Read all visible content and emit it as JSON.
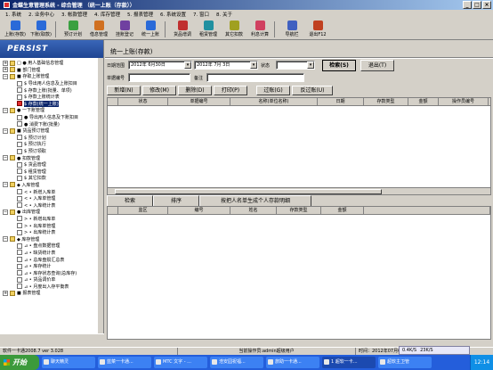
{
  "window": {
    "title": "金蝶生意管理系统 - 综合管理  （统一上账（存款））",
    "min": "_",
    "max": "□",
    "close": "×"
  },
  "menu": [
    "1. 系统",
    "2. 业务中心",
    "3. 帐款管理",
    "4. 库存管理",
    "5. 报表管理",
    "6. 系统设置",
    "7. 窗口",
    "8. 关于"
  ],
  "toolbar": [
    {
      "label": "上账(存款)",
      "icon_color": "#2a6ad8"
    },
    {
      "label": "下账(取款)",
      "icon_color": "#2a6ad8"
    },
    {
      "label": "预订计划",
      "icon_color": "#3aa040"
    },
    {
      "label": "借息管理",
      "icon_color": "#d07020"
    },
    {
      "label": "挂账登记",
      "icon_color": "#7040a0"
    },
    {
      "label": "统一上账",
      "icon_color": "#2a6ad8"
    },
    {
      "label": "货品增调",
      "icon_color": "#c03030"
    },
    {
      "label": "租赁管理",
      "icon_color": "#2090a0"
    },
    {
      "label": "其它扣款",
      "icon_color": "#a0a020"
    },
    {
      "label": "利息计算",
      "icon_color": "#d04060"
    },
    {
      "label": "导航栏",
      "icon_color": "#4060c0"
    },
    {
      "label": "退出F12",
      "icon_color": "#c04020"
    }
  ],
  "sidebar": {
    "brand": "PERSIST",
    "tree": [
      {
        "expander": "+",
        "icon": "folder",
        "label": "□ ● 用人基础信息管理",
        "indent": 0
      },
      {
        "expander": "+",
        "icon": "folder",
        "label": "■ 部门管理",
        "indent": 0
      },
      {
        "expander": "−",
        "icon": "folder",
        "label": "■ 存取上账管理",
        "indent": 0
      },
      {
        "expander": "",
        "icon": "doc",
        "label": "$ 导出用人信息及上账扣目",
        "indent": 1
      },
      {
        "expander": "",
        "icon": "doc",
        "label": "$ 存款上账(批量、单项)",
        "indent": 1
      },
      {
        "expander": "",
        "icon": "doc",
        "label": "$ 存款上账统计表",
        "indent": 1
      },
      {
        "expander": "",
        "icon": "sel",
        "label": "$ 存款(统一上账)",
        "indent": 1,
        "selected": true
      },
      {
        "expander": "−",
        "icon": "folder",
        "label": "● 一下账管理",
        "indent": 0
      },
      {
        "expander": "",
        "icon": "doc",
        "label": "● 导出用人信息及下账扣目",
        "indent": 1
      },
      {
        "expander": "",
        "icon": "doc",
        "label": "● 消费下账(批量)",
        "indent": 1
      },
      {
        "expander": "−",
        "icon": "folder",
        "label": "■ 货品预订管理",
        "indent": 0
      },
      {
        "expander": "",
        "icon": "doc",
        "label": "$ 预订计划",
        "indent": 1
      },
      {
        "expander": "",
        "icon": "doc",
        "label": "$ 预订执行",
        "indent": 1
      },
      {
        "expander": "",
        "icon": "doc",
        "label": "$ 预订领取",
        "indent": 1
      },
      {
        "expander": "−",
        "icon": "folder",
        "label": "● 扣款管理",
        "indent": 0
      },
      {
        "expander": "",
        "icon": "doc",
        "label": "$ 货品管理",
        "indent": 1
      },
      {
        "expander": "",
        "icon": "doc",
        "label": "$ 租赁管理",
        "indent": 1
      },
      {
        "expander": "",
        "icon": "doc",
        "label": "$ 其它扣款",
        "indent": 1
      },
      {
        "expander": "−",
        "icon": "folder",
        "label": "◆ 入库管理",
        "indent": 0
      },
      {
        "expander": "",
        "icon": "doc",
        "label": "< • 新增入库单",
        "indent": 1
      },
      {
        "expander": "",
        "icon": "doc",
        "label": "< • 入库单管理",
        "indent": 1
      },
      {
        "expander": "",
        "icon": "doc",
        "label": "< • 入库统计表",
        "indent": 1
      },
      {
        "expander": "−",
        "icon": "folder",
        "label": "● 出库管理",
        "indent": 0
      },
      {
        "expander": "",
        "icon": "doc",
        "label": "> • 新增出库单",
        "indent": 1
      },
      {
        "expander": "",
        "icon": "doc",
        "label": "> • 出库单管理",
        "indent": 1
      },
      {
        "expander": "",
        "icon": "doc",
        "label": "> • 出库统计表",
        "indent": 1
      },
      {
        "expander": "−",
        "icon": "folder",
        "label": "◆ 库存管理",
        "indent": 0
      },
      {
        "expander": "",
        "icon": "doc",
        "label": "⊿ • 盘点数据管理",
        "indent": 1
      },
      {
        "expander": "",
        "icon": "doc",
        "label": "⊿ • 缺货统计表",
        "indent": 1
      },
      {
        "expander": "",
        "icon": "doc",
        "label": "⊿ • 总库盘损汇总表",
        "indent": 1
      },
      {
        "expander": "",
        "icon": "doc",
        "label": "⊿ • 库存统计",
        "indent": 1
      },
      {
        "expander": "",
        "icon": "doc",
        "label": "⊿ • 库存状态查询(总库存)",
        "indent": 1
      },
      {
        "expander": "",
        "icon": "doc",
        "label": "⊿ • 货品调价单",
        "indent": 1
      },
      {
        "expander": "",
        "icon": "doc",
        "label": "⊿ • 月度出入存平衡表",
        "indent": 1
      },
      {
        "expander": "+",
        "icon": "folder",
        "label": "■ 报表管理",
        "indent": 0
      }
    ]
  },
  "form": {
    "title": "统一上账(存款)",
    "date_range_label": "日期范围",
    "date_from": "2012年 6月30日",
    "date_to": "2012年 7月 3日",
    "status_label": "状态",
    "status_value": "",
    "search_btn": "检索(S)",
    "exit_btn": "退出(T)",
    "order_no_label": "单据编号",
    "order_no_value": "",
    "remark_label": "备注",
    "remark_value": "",
    "action_buttons": [
      "新增(N)",
      "修改(M)",
      "删除(D)",
      "打印(P)",
      "过账(G)",
      "反过账(U)"
    ],
    "grid1_columns": [
      "",
      "状态",
      "单据编号",
      "名称(单位名称)",
      "日期",
      "存款类型",
      "金额",
      "操作员编号"
    ],
    "tabs": [
      "检索",
      "排序",
      "按把人名单生成个人存款明细"
    ],
    "grid2_columns": [
      "",
      "监区",
      "编号",
      "姓名",
      "存款类型",
      "金额",
      ""
    ]
  },
  "status_bar": {
    "left": "软件一卡通2008.7 ver 3.028",
    "user": "当前操作员:admin超级用户",
    "time": "时间：2012年07月03日 12:14:07"
  },
  "taskbar": {
    "start": "开始",
    "items": [
      "聊天精灵",
      "蓝菜一卡通...",
      "MTC 文字 - ...",
      "浩安园祝福...",
      "旅助一卡通...",
      "1 超软一卡...",
      "超软主卫管"
    ],
    "active_index": 5,
    "net_up": "0.4K/S",
    "net_down": "23K/S",
    "clock": "12:14"
  }
}
